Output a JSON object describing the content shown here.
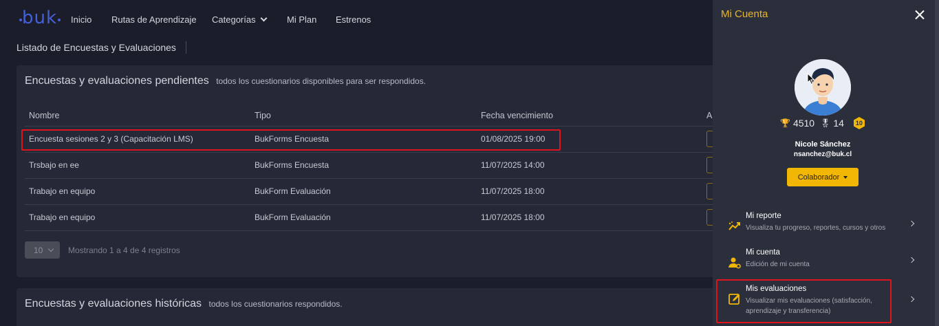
{
  "nav": {
    "logo": "buk",
    "items": [
      "Inicio",
      "Rutas de Aprendizaje",
      "Categorías",
      "Mi Plan",
      "Estrenos"
    ]
  },
  "page_title": "Listado de Encuestas y Evaluaciones",
  "pending": {
    "heading": "Encuestas y evaluaciones pendientes",
    "subheading": "todos los cuestionarios disponibles para ser respondidos.",
    "columns": [
      "Nombre",
      "Tipo",
      "Fecha vencimiento",
      "A"
    ],
    "rows": [
      {
        "name": "Encuesta sesiones 2 y 3 (Capacitación LMS)",
        "type": "BukForms Encuesta",
        "due": "01/08/2025 19:00"
      },
      {
        "name": "Trsbajo en ee",
        "type": "BukForms Encuesta",
        "due": "11/07/2025 14:00"
      },
      {
        "name": "Trabajo en equipo",
        "type": "BukForm Evaluación",
        "due": "11/07/2025 18:00"
      },
      {
        "name": "Trabajo en equipo",
        "type": "BukForm Evaluación",
        "due": "11/07/2025 18:00"
      }
    ],
    "page_size": "10",
    "pager_info": "Mostrando 1 a 4 de 4 registros"
  },
  "historic": {
    "heading": "Encuestas y evaluaciones históricas",
    "subheading": "todos los cuestionarios respondidos."
  },
  "account": {
    "title": "Mi Cuenta",
    "points": "4510",
    "medals": "14",
    "level": "10",
    "name": "Nicole Sánchez",
    "email": "nsanchez@buk.cl",
    "role": "Colaborador",
    "menu": [
      {
        "title": "Mi reporte",
        "desc": "Visualiza tu progreso, reportes, cursos y otros",
        "icon": "chart-trend-icon"
      },
      {
        "title": "Mi cuenta",
        "desc": "Edición de mi cuenta",
        "icon": "user-gear-icon"
      },
      {
        "title": "Mis evaluaciones",
        "desc": "Visualizar mis evaluaciones (satisfacción, aprendizaje y transferencia)",
        "icon": "edit-note-icon"
      }
    ]
  },
  "colors": {
    "accent": "#f2b705",
    "highlight": "#e0141d",
    "logo": "#4360d8"
  }
}
